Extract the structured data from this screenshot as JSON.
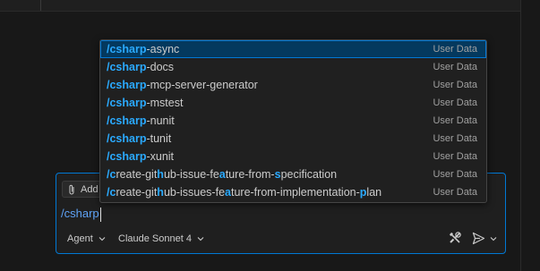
{
  "suggestions": [
    {
      "segments": [
        {
          "t": "/csharp",
          "h": true
        },
        {
          "t": "-async",
          "h": false
        }
      ],
      "tag": "User Data",
      "selected": true
    },
    {
      "segments": [
        {
          "t": "/csharp",
          "h": true
        },
        {
          "t": "-docs",
          "h": false
        }
      ],
      "tag": "User Data"
    },
    {
      "segments": [
        {
          "t": "/csharp",
          "h": true
        },
        {
          "t": "-mcp-server-generator",
          "h": false
        }
      ],
      "tag": "User Data"
    },
    {
      "segments": [
        {
          "t": "/csharp",
          "h": true
        },
        {
          "t": "-mstest",
          "h": false
        }
      ],
      "tag": "User Data"
    },
    {
      "segments": [
        {
          "t": "/csharp",
          "h": true
        },
        {
          "t": "-nunit",
          "h": false
        }
      ],
      "tag": "User Data"
    },
    {
      "segments": [
        {
          "t": "/csharp",
          "h": true
        },
        {
          "t": "-tunit",
          "h": false
        }
      ],
      "tag": "User Data"
    },
    {
      "segments": [
        {
          "t": "/csharp",
          "h": true
        },
        {
          "t": "-xunit",
          "h": false
        }
      ],
      "tag": "User Data"
    },
    {
      "segments": [
        {
          "t": "/c",
          "h": true
        },
        {
          "t": "reate-git",
          "h": false
        },
        {
          "t": "h",
          "h": true
        },
        {
          "t": "ub-issue-fe",
          "h": false
        },
        {
          "t": "a",
          "h": true
        },
        {
          "t": "ture-from-",
          "h": false
        },
        {
          "t": "s",
          "h": true
        },
        {
          "t": "pecification",
          "h": false
        }
      ],
      "tag": "User Data"
    },
    {
      "segments": [
        {
          "t": "/c",
          "h": true
        },
        {
          "t": "reate-git",
          "h": false
        },
        {
          "t": "h",
          "h": true
        },
        {
          "t": "ub-issues-fe",
          "h": false
        },
        {
          "t": "a",
          "h": true
        },
        {
          "t": "ture-from-implementation-",
          "h": false
        },
        {
          "t": "p",
          "h": true
        },
        {
          "t": "lan",
          "h": false
        }
      ],
      "tag": "User Data"
    }
  ],
  "chat": {
    "attach_label": "Add",
    "input_value": "/csharp",
    "mode_label": "Agent",
    "model_label": "Claude Sonnet 4"
  },
  "icons": {
    "attach": "paperclip-icon",
    "tools": "tools-icon",
    "send": "send-icon",
    "chevron": "chevron-down-icon"
  },
  "colors": {
    "accent": "#0078d4",
    "highlight": "#2aaaff",
    "selected_bg": "#04395e"
  }
}
